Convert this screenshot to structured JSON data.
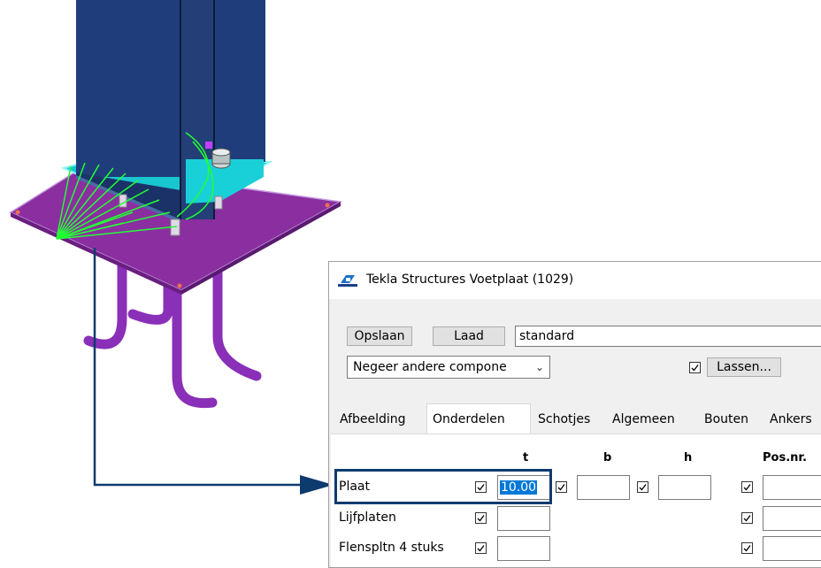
{
  "dialog": {
    "title": "Tekla Structures  Voetplaat (1029)",
    "save_label": "Opslaan",
    "load_label": "Laad",
    "saveas_value": "standard",
    "ignore_select_value": "Negeer andere compone",
    "welds_checked": true,
    "welds_label": "Lassen...",
    "tabs": [
      {
        "label": "Afbeelding",
        "active": false
      },
      {
        "label": "Onderdelen",
        "active": true
      },
      {
        "label": "Schotjes",
        "active": false
      },
      {
        "label": "Algemeen",
        "active": false
      },
      {
        "label": "Bouten",
        "active": false
      },
      {
        "label": "Ankers",
        "active": false
      }
    ],
    "columns": {
      "t": "t",
      "b": "b",
      "h": "h",
      "posnr": "Pos.nr."
    },
    "rows": [
      {
        "label": "Plaat",
        "t_value": "10.00"
      },
      {
        "label": "Lijfplaten",
        "t_value": ""
      },
      {
        "label": "Flenspltn 4 stuks",
        "t_value": ""
      }
    ]
  },
  "colors": {
    "column": "#1f3d7a",
    "baseplate": "#8b2ea0",
    "anchor_rods": "#8a2fb8",
    "cap_plate": "#19d0d8",
    "weld_lines": "#22ff33",
    "callout": "#0d3b6e"
  }
}
